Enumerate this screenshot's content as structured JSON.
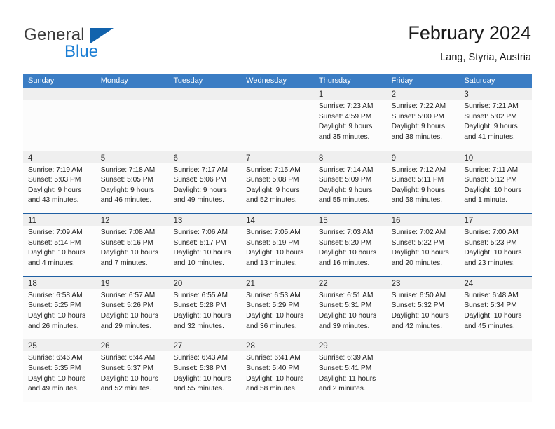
{
  "brand": {
    "word_one": "General",
    "word_two": "Blue",
    "flag_icon": "blue-triangle-flag"
  },
  "header": {
    "title": "February 2024",
    "subtitle": "Lang, Styria, Austria"
  },
  "colors": {
    "header_blue": "#3b7dc4",
    "grid_line_blue": "#1f5fa3",
    "brand_blue": "#1d7fd4",
    "day_strip_gray": "#efefef"
  },
  "calendar": {
    "day_headers": [
      "Sunday",
      "Monday",
      "Tuesday",
      "Wednesday",
      "Thursday",
      "Friday",
      "Saturday"
    ],
    "weeks": [
      [
        {
          "empty": true
        },
        {
          "empty": true
        },
        {
          "empty": true
        },
        {
          "empty": true
        },
        {
          "day": "1",
          "sunrise": "Sunrise: 7:23 AM",
          "sunset": "Sunset: 4:59 PM",
          "daylight_1": "Daylight: 9 hours",
          "daylight_2": "and 35 minutes."
        },
        {
          "day": "2",
          "sunrise": "Sunrise: 7:22 AM",
          "sunset": "Sunset: 5:00 PM",
          "daylight_1": "Daylight: 9 hours",
          "daylight_2": "and 38 minutes."
        },
        {
          "day": "3",
          "sunrise": "Sunrise: 7:21 AM",
          "sunset": "Sunset: 5:02 PM",
          "daylight_1": "Daylight: 9 hours",
          "daylight_2": "and 41 minutes."
        }
      ],
      [
        {
          "day": "4",
          "sunrise": "Sunrise: 7:19 AM",
          "sunset": "Sunset: 5:03 PM",
          "daylight_1": "Daylight: 9 hours",
          "daylight_2": "and 43 minutes."
        },
        {
          "day": "5",
          "sunrise": "Sunrise: 7:18 AM",
          "sunset": "Sunset: 5:05 PM",
          "daylight_1": "Daylight: 9 hours",
          "daylight_2": "and 46 minutes."
        },
        {
          "day": "6",
          "sunrise": "Sunrise: 7:17 AM",
          "sunset": "Sunset: 5:06 PM",
          "daylight_1": "Daylight: 9 hours",
          "daylight_2": "and 49 minutes."
        },
        {
          "day": "7",
          "sunrise": "Sunrise: 7:15 AM",
          "sunset": "Sunset: 5:08 PM",
          "daylight_1": "Daylight: 9 hours",
          "daylight_2": "and 52 minutes."
        },
        {
          "day": "8",
          "sunrise": "Sunrise: 7:14 AM",
          "sunset": "Sunset: 5:09 PM",
          "daylight_1": "Daylight: 9 hours",
          "daylight_2": "and 55 minutes."
        },
        {
          "day": "9",
          "sunrise": "Sunrise: 7:12 AM",
          "sunset": "Sunset: 5:11 PM",
          "daylight_1": "Daylight: 9 hours",
          "daylight_2": "and 58 minutes."
        },
        {
          "day": "10",
          "sunrise": "Sunrise: 7:11 AM",
          "sunset": "Sunset: 5:12 PM",
          "daylight_1": "Daylight: 10 hours",
          "daylight_2": "and 1 minute."
        }
      ],
      [
        {
          "day": "11",
          "sunrise": "Sunrise: 7:09 AM",
          "sunset": "Sunset: 5:14 PM",
          "daylight_1": "Daylight: 10 hours",
          "daylight_2": "and 4 minutes."
        },
        {
          "day": "12",
          "sunrise": "Sunrise: 7:08 AM",
          "sunset": "Sunset: 5:16 PM",
          "daylight_1": "Daylight: 10 hours",
          "daylight_2": "and 7 minutes."
        },
        {
          "day": "13",
          "sunrise": "Sunrise: 7:06 AM",
          "sunset": "Sunset: 5:17 PM",
          "daylight_1": "Daylight: 10 hours",
          "daylight_2": "and 10 minutes."
        },
        {
          "day": "14",
          "sunrise": "Sunrise: 7:05 AM",
          "sunset": "Sunset: 5:19 PM",
          "daylight_1": "Daylight: 10 hours",
          "daylight_2": "and 13 minutes."
        },
        {
          "day": "15",
          "sunrise": "Sunrise: 7:03 AM",
          "sunset": "Sunset: 5:20 PM",
          "daylight_1": "Daylight: 10 hours",
          "daylight_2": "and 16 minutes."
        },
        {
          "day": "16",
          "sunrise": "Sunrise: 7:02 AM",
          "sunset": "Sunset: 5:22 PM",
          "daylight_1": "Daylight: 10 hours",
          "daylight_2": "and 20 minutes."
        },
        {
          "day": "17",
          "sunrise": "Sunrise: 7:00 AM",
          "sunset": "Sunset: 5:23 PM",
          "daylight_1": "Daylight: 10 hours",
          "daylight_2": "and 23 minutes."
        }
      ],
      [
        {
          "day": "18",
          "sunrise": "Sunrise: 6:58 AM",
          "sunset": "Sunset: 5:25 PM",
          "daylight_1": "Daylight: 10 hours",
          "daylight_2": "and 26 minutes."
        },
        {
          "day": "19",
          "sunrise": "Sunrise: 6:57 AM",
          "sunset": "Sunset: 5:26 PM",
          "daylight_1": "Daylight: 10 hours",
          "daylight_2": "and 29 minutes."
        },
        {
          "day": "20",
          "sunrise": "Sunrise: 6:55 AM",
          "sunset": "Sunset: 5:28 PM",
          "daylight_1": "Daylight: 10 hours",
          "daylight_2": "and 32 minutes."
        },
        {
          "day": "21",
          "sunrise": "Sunrise: 6:53 AM",
          "sunset": "Sunset: 5:29 PM",
          "daylight_1": "Daylight: 10 hours",
          "daylight_2": "and 36 minutes."
        },
        {
          "day": "22",
          "sunrise": "Sunrise: 6:51 AM",
          "sunset": "Sunset: 5:31 PM",
          "daylight_1": "Daylight: 10 hours",
          "daylight_2": "and 39 minutes."
        },
        {
          "day": "23",
          "sunrise": "Sunrise: 6:50 AM",
          "sunset": "Sunset: 5:32 PM",
          "daylight_1": "Daylight: 10 hours",
          "daylight_2": "and 42 minutes."
        },
        {
          "day": "24",
          "sunrise": "Sunrise: 6:48 AM",
          "sunset": "Sunset: 5:34 PM",
          "daylight_1": "Daylight: 10 hours",
          "daylight_2": "and 45 minutes."
        }
      ],
      [
        {
          "day": "25",
          "sunrise": "Sunrise: 6:46 AM",
          "sunset": "Sunset: 5:35 PM",
          "daylight_1": "Daylight: 10 hours",
          "daylight_2": "and 49 minutes."
        },
        {
          "day": "26",
          "sunrise": "Sunrise: 6:44 AM",
          "sunset": "Sunset: 5:37 PM",
          "daylight_1": "Daylight: 10 hours",
          "daylight_2": "and 52 minutes."
        },
        {
          "day": "27",
          "sunrise": "Sunrise: 6:43 AM",
          "sunset": "Sunset: 5:38 PM",
          "daylight_1": "Daylight: 10 hours",
          "daylight_2": "and 55 minutes."
        },
        {
          "day": "28",
          "sunrise": "Sunrise: 6:41 AM",
          "sunset": "Sunset: 5:40 PM",
          "daylight_1": "Daylight: 10 hours",
          "daylight_2": "and 58 minutes."
        },
        {
          "day": "29",
          "sunrise": "Sunrise: 6:39 AM",
          "sunset": "Sunset: 5:41 PM",
          "daylight_1": "Daylight: 11 hours",
          "daylight_2": "and 2 minutes."
        },
        {
          "empty": true
        },
        {
          "empty": true
        }
      ]
    ]
  }
}
